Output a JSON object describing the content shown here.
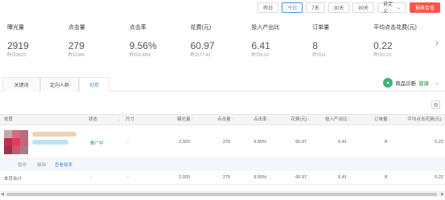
{
  "datebar": {
    "yesterday": "昨日",
    "today": "今日",
    "d7": "7天",
    "d30": "30天",
    "d90": "90天",
    "custom": "自定义",
    "custom_chevron": "chevron-down-icon",
    "report": "报表合览"
  },
  "metrics": [
    {
      "name": "曝光量",
      "value": "2919",
      "prev": "昨日3623"
    },
    {
      "name": "点击量",
      "value": "279",
      "prev": "昨日340"
    },
    {
      "name": "点击率",
      "value": "9.56%",
      "prev": "昨日9.38%"
    },
    {
      "name": "花费(元)",
      "value": "60.97",
      "prev": "昨日77.43"
    },
    {
      "name": "投入产出比",
      "value": "6.41",
      "prev": "昨日5.12"
    },
    {
      "name": "订单量",
      "value": "8",
      "prev": "昨日11"
    },
    {
      "name": "平均点击花费(元)",
      "value": "0.22",
      "prev": "昨日0.23"
    }
  ],
  "tabs": {
    "keyword": "关键词",
    "audience": "定向人群",
    "creative": "创意"
  },
  "diagnosis": {
    "label": "商品诊断",
    "status": "健康"
  },
  "table": {
    "headers": {
      "creative": "创意",
      "status": "状态",
      "size": "尺寸",
      "impressions": "曝光量",
      "clicks": "点击量",
      "ctr": "点击率",
      "cost": "花费(元)",
      "roi": "投入产出比",
      "orders": "订单量",
      "avg_cpc": "平均点击花费(元)"
    },
    "row": {
      "status": "推广中",
      "size": "-",
      "impressions": "2,920",
      "clicks": "279",
      "ctr": "9.55%",
      "cost": "60.97",
      "roi": "6.41",
      "orders": "8",
      "avg_cpc": "0.22"
    },
    "actions": {
      "pause": "暂停",
      "edit": "编辑",
      "report": "查看报表"
    },
    "total": {
      "label": "本页合计",
      "status": "-",
      "size": "-",
      "impressions": "2,920",
      "clicks": "279",
      "ctr": "9.55%",
      "cost": "60.97",
      "roi": "6.41",
      "orders": "8",
      "avg_cpc": "0.22"
    }
  },
  "colors": {
    "accent": "#4a90e2",
    "report_button": "#ff5548",
    "status_green": "#2e9d52"
  }
}
